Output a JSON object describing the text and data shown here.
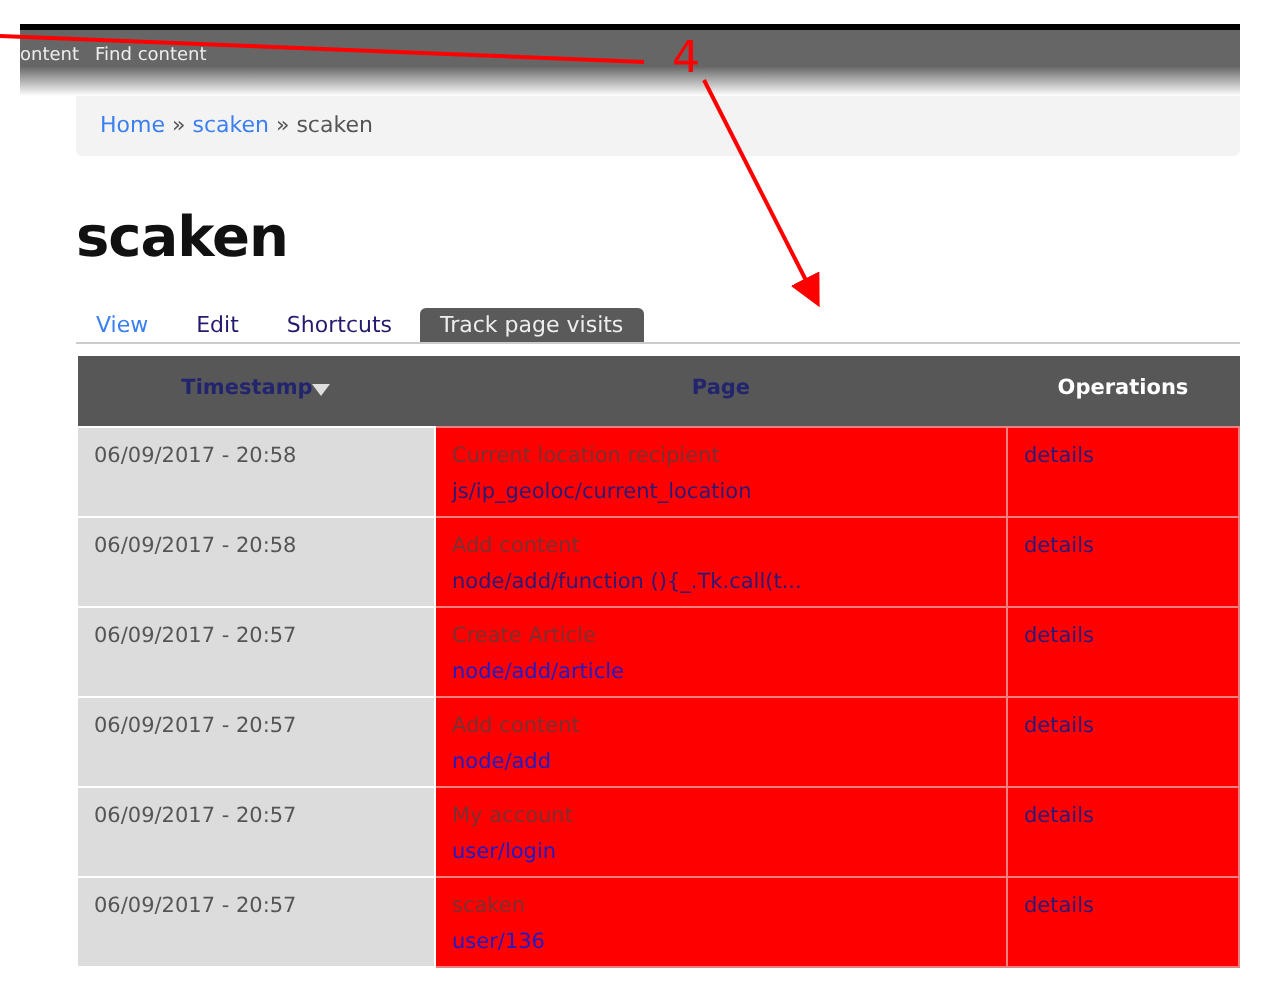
{
  "toolbar": {
    "items": [
      "ontent",
      "Find content"
    ]
  },
  "breadcrumb": [
    {
      "label": "Home",
      "link": true
    },
    {
      "label": "scaken",
      "link": true
    },
    {
      "label": "scaken",
      "link": false
    }
  ],
  "breadcrumb_separator": "»",
  "title": "scaken",
  "tabs": [
    {
      "label": "View",
      "selected": false,
      "visited": false
    },
    {
      "label": "Edit",
      "selected": false,
      "visited": true
    },
    {
      "label": "Shortcuts",
      "selected": false,
      "visited": true
    },
    {
      "label": "Track page visits",
      "selected": true,
      "visited": false
    }
  ],
  "table": {
    "columns": [
      {
        "label": "Timestamp",
        "sortable": true,
        "sorted": true
      },
      {
        "label": "Page",
        "sortable": true,
        "sorted": false
      },
      {
        "label": "Operations",
        "sortable": false,
        "sorted": false
      }
    ],
    "rows": [
      {
        "timestamp": "06/09/2017 - 20:58",
        "page_title": "Current location recipient",
        "path": "js/ip_geoloc/current_location",
        "path_visited": true,
        "operation": "details"
      },
      {
        "timestamp": "06/09/2017 - 20:58",
        "page_title": "Add content",
        "path": "node/add/function (){_.Tk.call(t...",
        "path_visited": true,
        "operation": "details"
      },
      {
        "timestamp": "06/09/2017 - 20:57",
        "page_title": "Create Article",
        "path": "node/add/article",
        "path_visited": false,
        "operation": "details"
      },
      {
        "timestamp": "06/09/2017 - 20:57",
        "page_title": "Add content",
        "path": "node/add",
        "path_visited": false,
        "operation": "details"
      },
      {
        "timestamp": "06/09/2017 - 20:57",
        "page_title": "My account",
        "path": "user/login",
        "path_visited": false,
        "operation": "details"
      },
      {
        "timestamp": "06/09/2017 - 20:57",
        "page_title": "scaken",
        "path": "user/136",
        "path_visited": false,
        "operation": "details"
      }
    ]
  },
  "annotation": {
    "label": "4"
  }
}
